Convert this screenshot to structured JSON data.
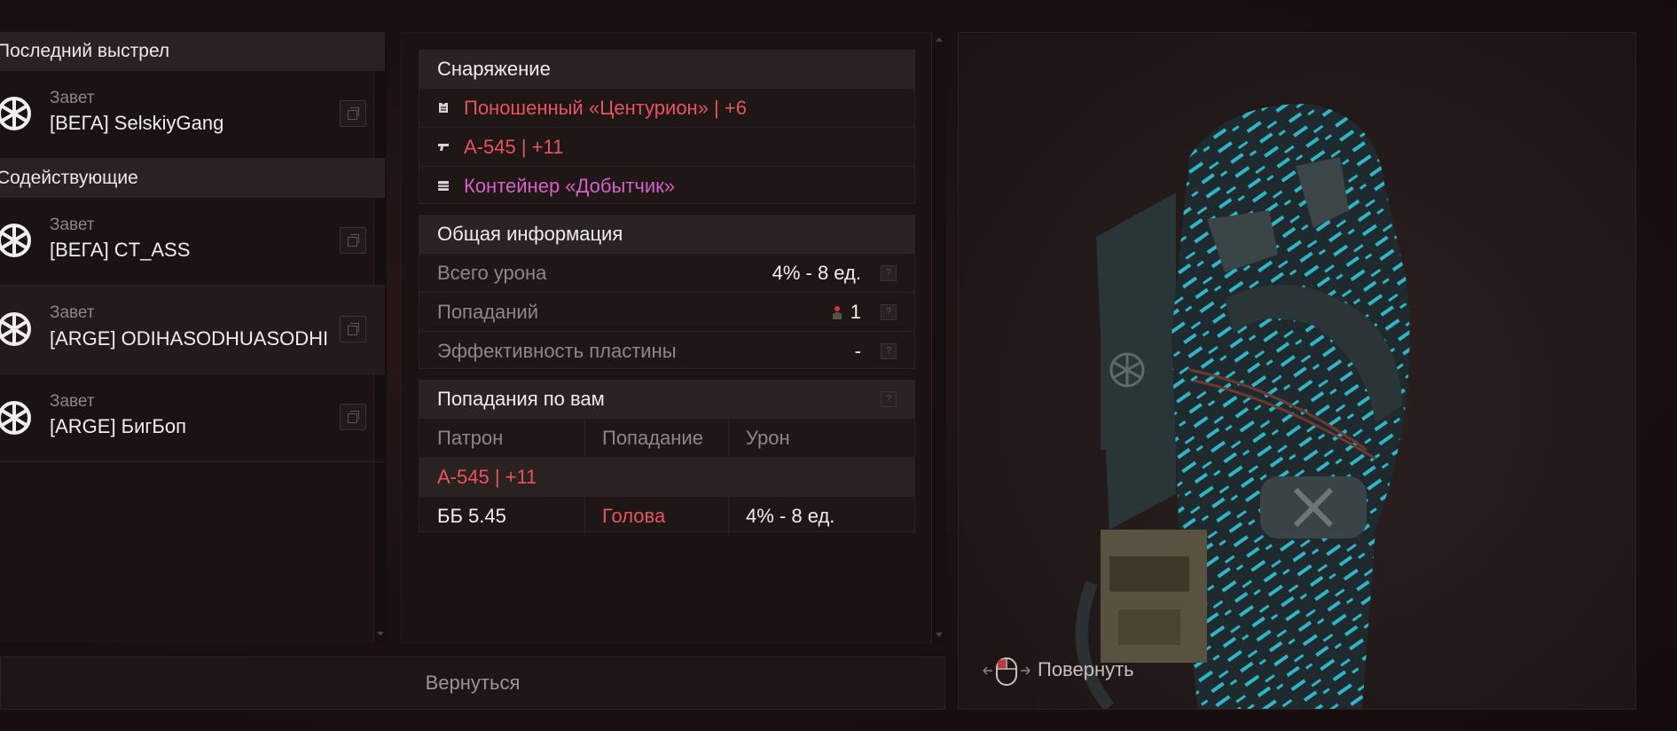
{
  "killers": {
    "last_shot_header": "Последний выстрел",
    "assists_header": "Содействующие",
    "last_shot": {
      "faction": "Завет",
      "name": "[ВЕГА] SelskiyGang"
    },
    "assists": [
      {
        "faction": "Завет",
        "name": "[ВЕГА] CT_ASS"
      },
      {
        "faction": "Завет",
        "name": "[ARGE] ODIHASODHUASODHI"
      },
      {
        "faction": "Завет",
        "name": "[ARGE] БигБоп"
      }
    ]
  },
  "equipment": {
    "title": "Снаряжение",
    "items": [
      {
        "icon": "armor-icon",
        "name": "Поношенный «Центурион» | +6",
        "color": "#e8545c"
      },
      {
        "icon": "rifle-icon",
        "name": "А-545 | +11",
        "color": "#e8545c"
      },
      {
        "icon": "container-icon",
        "name": "Контейнер «Добытчик»",
        "color": "#d85fc8"
      }
    ]
  },
  "general_info": {
    "title": "Общая информация",
    "stats": [
      {
        "label": "Всего урона",
        "value": "4% - 8 ед."
      },
      {
        "label": "Попаданий",
        "value": "1"
      },
      {
        "label": "Эффективность пластины",
        "value": "-"
      }
    ],
    "help": "?"
  },
  "hits": {
    "title": "Попадания по вам",
    "columns": [
      "Патрон",
      "Попадание",
      "Урон"
    ],
    "weapon": "А-545 | +11",
    "rows": [
      {
        "ammo": "ББ 5.45",
        "location": "Голова",
        "damage": "4% - 8 ед."
      }
    ]
  },
  "back_button": "Вернуться",
  "rotate_hint": "Повернуть",
  "colors": {
    "red": "#e8545c",
    "pink": "#d85fc8",
    "teal": "#2fb6c6"
  }
}
